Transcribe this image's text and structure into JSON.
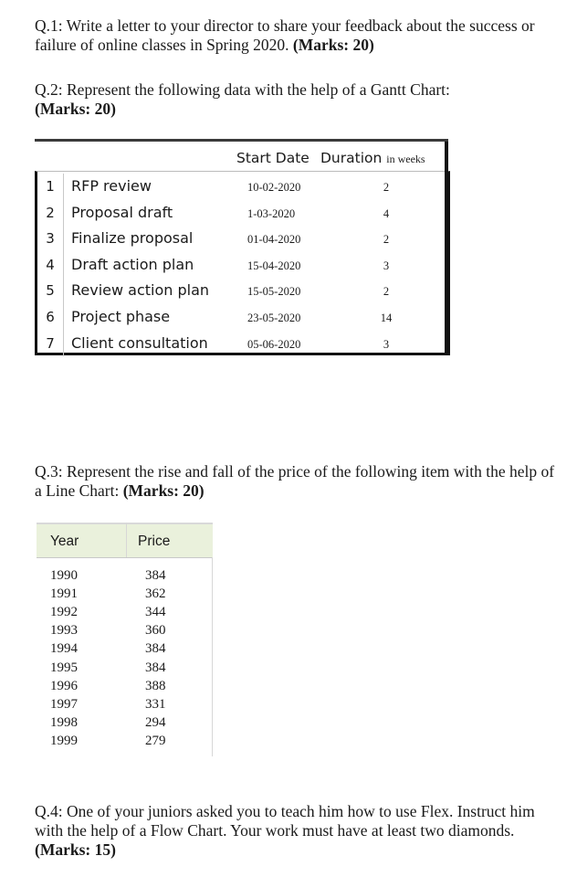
{
  "q1": {
    "text": "Q.1: Write a letter to your director to share your feedback about the success or failure of online classes in Spring 2020.",
    "marks": "(Marks: 20)"
  },
  "q2": {
    "text": "Q.2: Represent the following data with the help of a Gantt Chart:",
    "marks": "(Marks: 20)"
  },
  "gantt_table": {
    "header_start": "Start Date",
    "header_duration": "Duration",
    "header_duration_unit": "in weeks",
    "rows": [
      {
        "index": "1",
        "task": "RFP review",
        "start": "10-02-2020",
        "duration": "2"
      },
      {
        "index": "2",
        "task": "Proposal draft",
        "start": "1-03-2020",
        "duration": "4"
      },
      {
        "index": "3",
        "task": "Finalize proposal",
        "start": "01-04-2020",
        "duration": "2"
      },
      {
        "index": "4",
        "task": "Draft action plan",
        "start": "15-04-2020",
        "duration": "3"
      },
      {
        "index": "5",
        "task": "Review action plan",
        "start": "15-05-2020",
        "duration": "2"
      },
      {
        "index": "6",
        "task": "Project phase",
        "start": "23-05-2020",
        "duration": "14"
      },
      {
        "index": "7",
        "task": "Client consultation",
        "start": "05-06-2020",
        "duration": "3"
      }
    ]
  },
  "q3": {
    "text": "Q.3: Represent the rise and fall of the price of the following item with the help of a Line Chart:",
    "marks": "(Marks: 20)"
  },
  "price_table": {
    "header_year": "Year",
    "header_price": "Price",
    "rows": [
      {
        "year": "1990",
        "price": "384"
      },
      {
        "year": "1991",
        "price": "362"
      },
      {
        "year": "1992",
        "price": "344"
      },
      {
        "year": "1993",
        "price": "360"
      },
      {
        "year": "1994",
        "price": "384"
      },
      {
        "year": "1995",
        "price": "384"
      },
      {
        "year": "1996",
        "price": "388"
      },
      {
        "year": "1997",
        "price": "331"
      },
      {
        "year": "1998",
        "price": "294"
      },
      {
        "year": "1999",
        "price": "279"
      }
    ]
  },
  "q4": {
    "text": "Q.4: One of your juniors asked you to teach him how to use Flex. Instruct him with the help of a Flow Chart. Your work must have at least two diamonds.",
    "marks": "(Marks: 15)"
  }
}
